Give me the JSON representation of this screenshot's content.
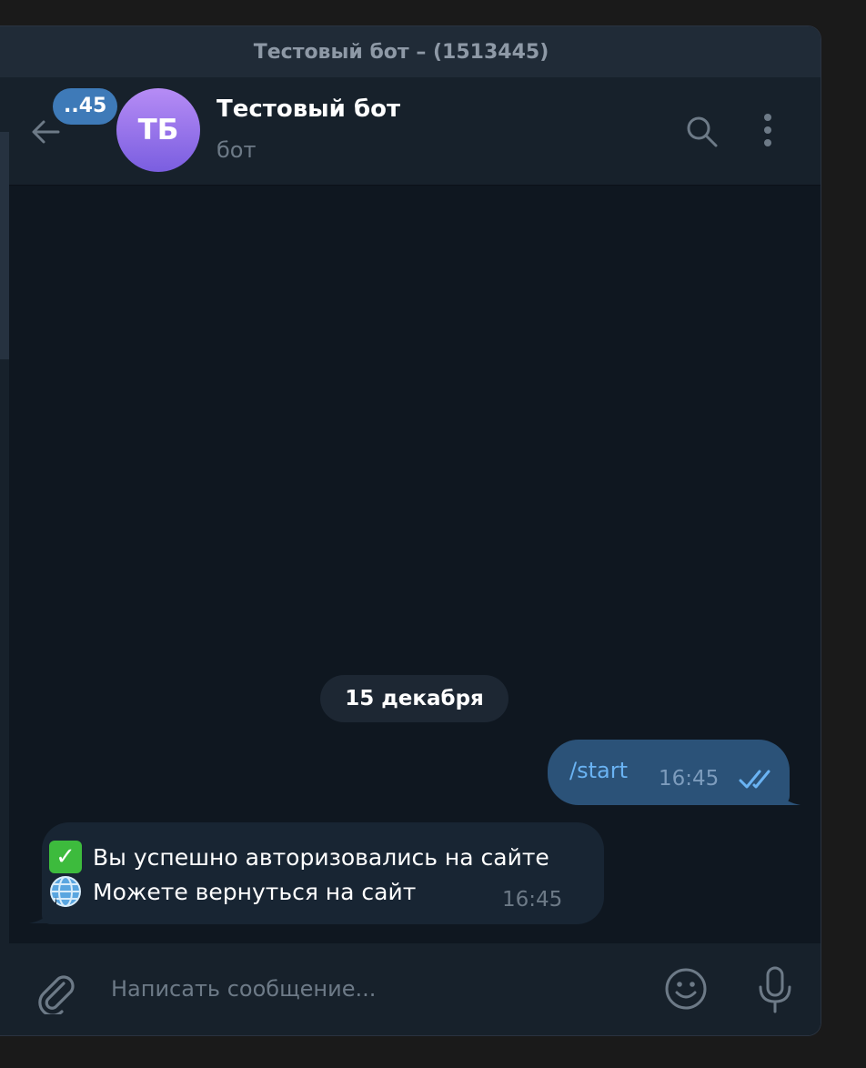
{
  "window": {
    "title": "Тестовый бот – (1513445)"
  },
  "header": {
    "unread_badge": "..45",
    "avatar_initials": "ТБ",
    "chat_name": "Тестовый бот",
    "chat_status": "бот"
  },
  "chat": {
    "date_separator": "15 декабря",
    "outgoing": {
      "text": "/start",
      "time": "16:45",
      "status_icon": "double-check-icon"
    },
    "incoming": {
      "line1": "Вы успешно авторизовались на сайте",
      "line2": "Можете вернуться на сайт",
      "time": "16:45",
      "line1_emoji": "check-mark-button-emoji",
      "line2_emoji": "globe-emoji"
    }
  },
  "composer": {
    "placeholder": "Написать сообщение..."
  },
  "colors": {
    "background": "#0f1720",
    "panel": "#17212b",
    "outgoing_bubble": "#2b5278",
    "incoming_bubble": "#182533",
    "accent": "#6ab3f3",
    "badge": "#3e7ab8"
  },
  "icons": {
    "back": "arrow-left-icon",
    "search": "search-icon",
    "more": "more-vertical-icon",
    "attach": "paperclip-icon",
    "emoji": "smile-icon",
    "mic": "microphone-icon"
  }
}
